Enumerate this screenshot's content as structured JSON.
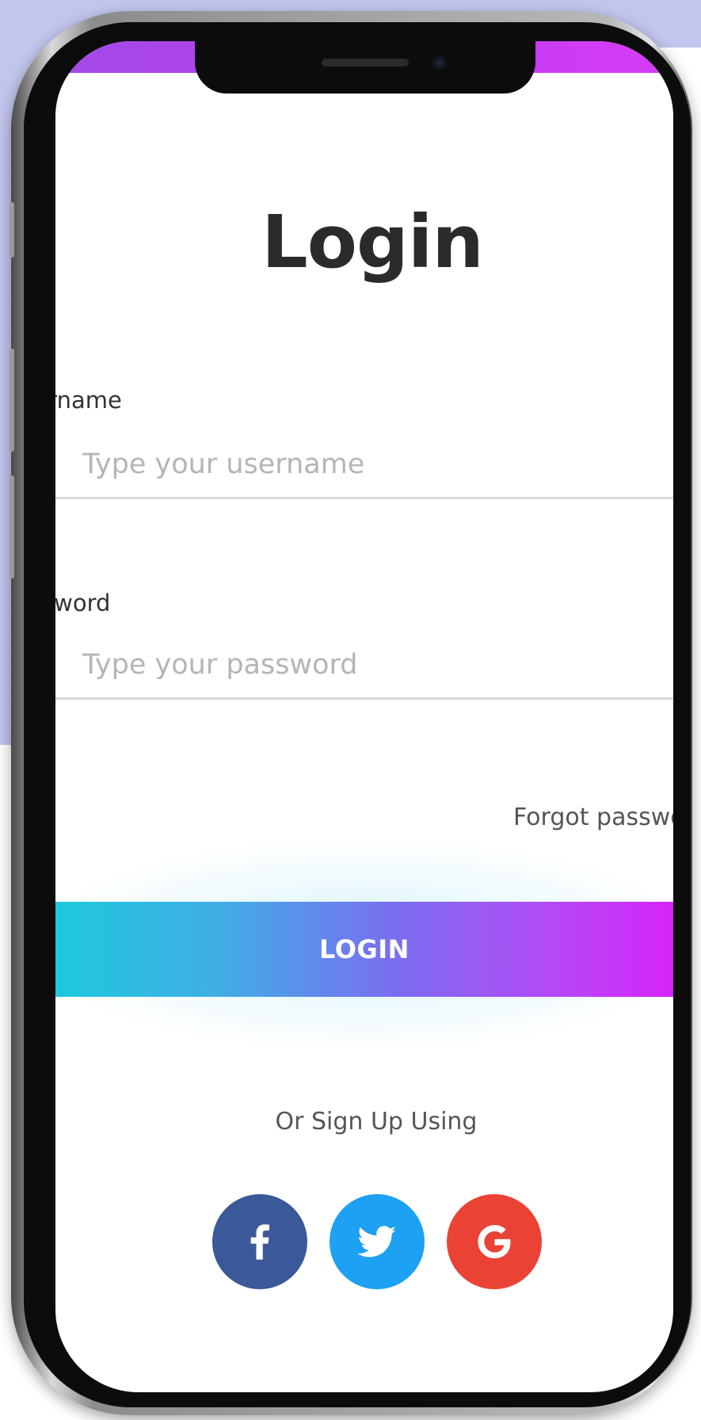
{
  "screen": {
    "title": "Login",
    "username": {
      "label": "Username",
      "placeholder": "Type your username",
      "value": ""
    },
    "password": {
      "label": "Password",
      "placeholder": "Type your password",
      "value": ""
    },
    "forgot_password_label": "Forgot password?",
    "login_button_label": "LOGIN",
    "signup_prompt": "Or Sign Up Using",
    "social_buttons": [
      {
        "name": "facebook",
        "icon": "facebook-icon",
        "color": "#3b5998"
      },
      {
        "name": "twitter",
        "icon": "twitter-icon",
        "color": "#1da1f2"
      },
      {
        "name": "google",
        "icon": "google-icon",
        "color": "#ea4335"
      }
    ]
  },
  "colors": {
    "gradient_start": "#1ec8dd",
    "gradient_end": "#d624fa",
    "background_panel": "#c2c5ec"
  }
}
